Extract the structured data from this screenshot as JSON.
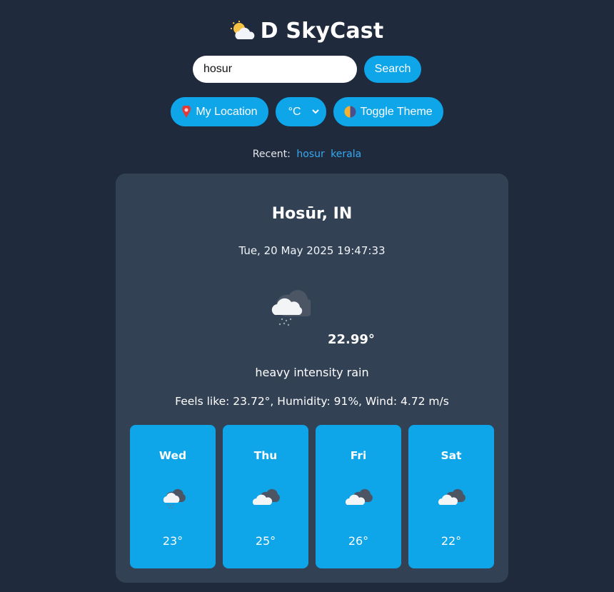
{
  "app": {
    "title": "D SkyCast",
    "logo_icon": "sun-behind-cloud-icon"
  },
  "search": {
    "value": "hosur",
    "placeholder": "",
    "button_label": "Search"
  },
  "controls": {
    "location_icon": "pin-icon",
    "location_label": "My Location",
    "unit_selected": "°C",
    "theme_icon": "half-moon-icon",
    "theme_label": "Toggle Theme"
  },
  "recent": {
    "label": "Recent:",
    "items": [
      "hosur",
      "kerala"
    ]
  },
  "current": {
    "city": "Hosūr, IN",
    "datetime": "Tue, 20 May 2025 19:47:33",
    "icon": "cloud-rain-night-icon",
    "temperature": "22.99°",
    "description": "heavy intensity rain",
    "details": "Feels like: 23.72°, Humidity: 91%, Wind: 4.72 m/s"
  },
  "forecast": [
    {
      "day": "Wed",
      "icon": "rain-cloud-icon",
      "temp": "23°"
    },
    {
      "day": "Thu",
      "icon": "broken-clouds-icon",
      "temp": "25°"
    },
    {
      "day": "Fri",
      "icon": "broken-clouds-icon",
      "temp": "26°"
    },
    {
      "day": "Sat",
      "icon": "broken-clouds-icon",
      "temp": "22°"
    }
  ],
  "colors": {
    "background": "#1f2a3c",
    "card": "#334155",
    "accent": "#0ea5e9"
  }
}
